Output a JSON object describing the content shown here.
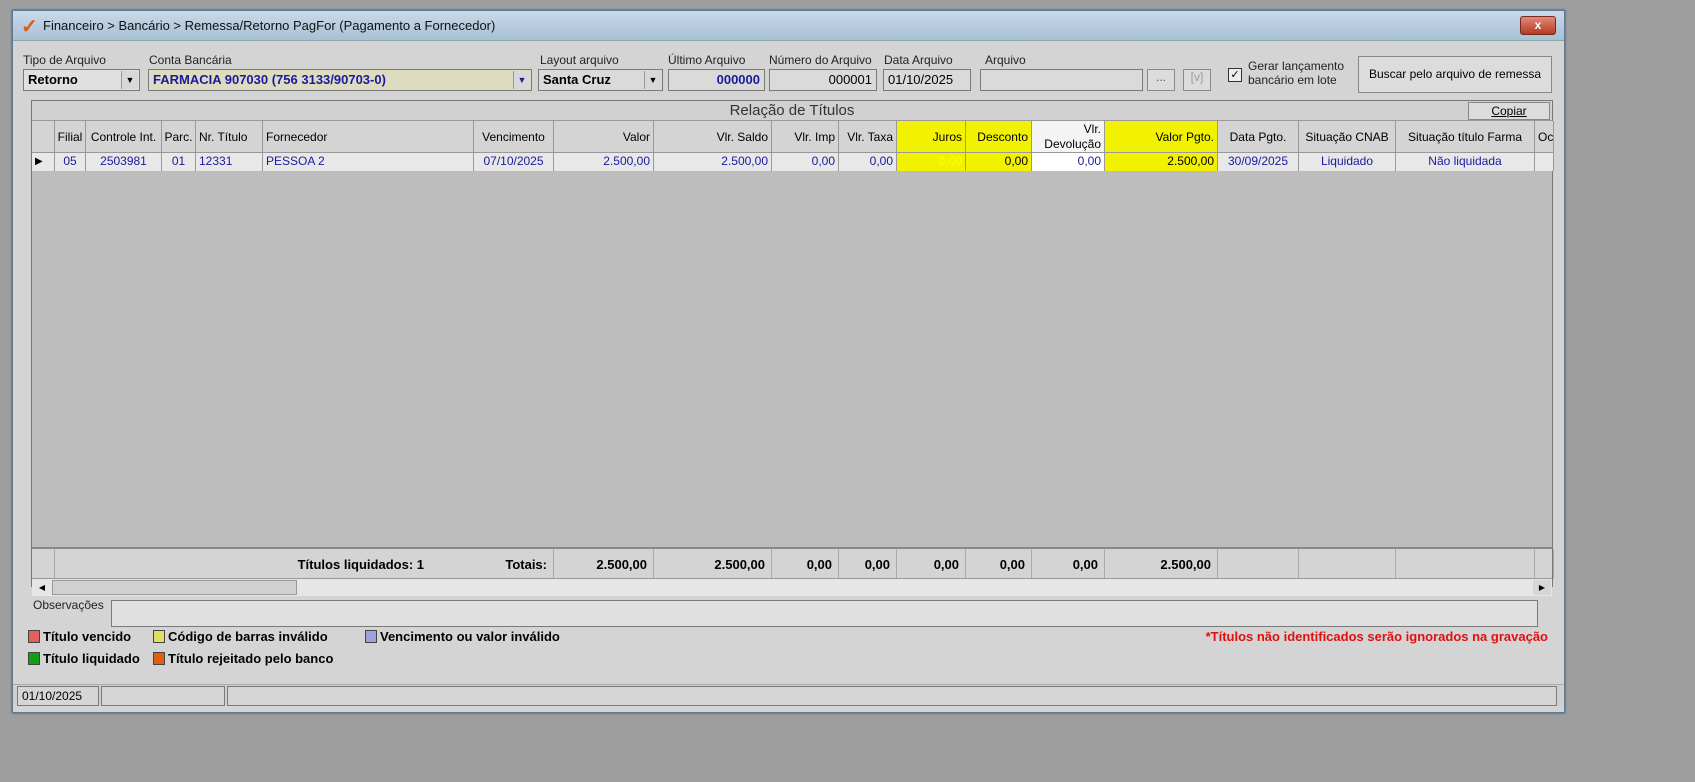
{
  "window": {
    "title": "Financeiro > Bancário > Remessa/Retorno PagFor (Pagamento  a Fornecedor)",
    "close": "x"
  },
  "form": {
    "tipo_label": "Tipo de Arquivo",
    "tipo_value": "Retorno",
    "conta_label": "Conta Bancária",
    "conta_value": "FARMACIA 907030 (756 3133/90703-0)",
    "layout_label": "Layout arquivo",
    "layout_value": "Santa Cruz",
    "ultimo_label": "Último Arquivo",
    "ultimo_value": "000000",
    "numero_label": "Número do Arquivo",
    "numero_value": "000001",
    "data_label": "Data Arquivo",
    "data_value": "01/10/2025",
    "arquivo_label": "Arquivo",
    "arquivo_value": "",
    "browse_btn": "...",
    "validate_btn": "[v]",
    "gerar_label_1": "Gerar lançamento",
    "gerar_label_2": "bancário em lote",
    "gerar_checked": true,
    "buscar_btn": "Buscar pelo arquivo de remessa"
  },
  "grid": {
    "title": "Relação de Títulos",
    "copiar": "Copiar",
    "columns": [
      "Filial",
      "Controle Int.",
      "Parc.",
      "Nr. Título",
      "Fornecedor",
      "Vencimento",
      "Valor",
      "Vlr. Saldo",
      "Vlr. Imp",
      "Vlr. Taxa",
      "Juros",
      "Desconto",
      "Vlr. Devolução",
      "Valor Pgto.",
      "Data Pgto.",
      "Situação CNAB",
      "Situação título Farma",
      "Oc"
    ],
    "rows": [
      [
        "05",
        "2503981",
        "01",
        "12331",
        "PESSOA 2",
        "07/10/2025",
        "2.500,00",
        "2.500,00",
        "0,00",
        "0,00",
        "0,00",
        "0,00",
        "0,00",
        "2.500,00",
        "30/09/2025",
        "Liquidado",
        "Não liquidada",
        ""
      ]
    ],
    "totals": {
      "liquidados": "Títulos liquidados: 1",
      "label": "Totais:",
      "values": [
        "2.500,00",
        "2.500,00",
        "0,00",
        "0,00",
        "0,00",
        "0,00",
        "0,00",
        "2.500,00"
      ]
    }
  },
  "observacoes_label": "Observações",
  "observacoes_value": "",
  "legend": [
    {
      "label": "Título vencido",
      "color": "#e06060"
    },
    {
      "label": "Código de barras inválido",
      "color": "#e0e060"
    },
    {
      "label": "Vencimento ou valor inválido",
      "color": "#a0a0e0"
    },
    {
      "label": "Título liquidado",
      "color": "#10a010"
    },
    {
      "label": "Título rejeitado pelo banco",
      "color": "#e06010"
    }
  ],
  "warning": "*Títulos não identificados serão ignorados na gravação",
  "status": {
    "date": "01/10/2025"
  }
}
